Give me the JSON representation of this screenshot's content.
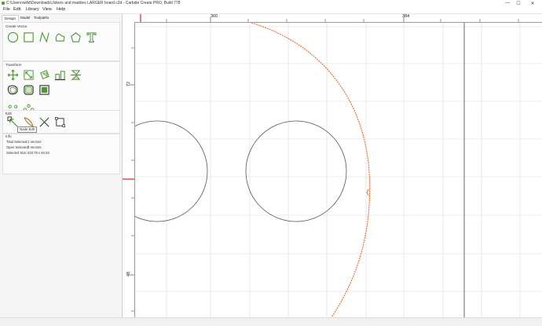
{
  "window": {
    "title": "C:\\Users\\willd\\Downloads\\Jokers and marbles LARGER board.c2d - Carbide Create PRO, Build 778",
    "minimize_glyph": "—",
    "maximize_glyph": "☐",
    "close_glyph": "✕"
  },
  "menu": {
    "file": "File",
    "edit": "Edit",
    "library": "Library",
    "view": "View",
    "help": "Help"
  },
  "tabs": {
    "design": "Design",
    "model": "Model",
    "toolpaths": "Toolpaths"
  },
  "sections": {
    "create_vector": "Create Vector",
    "transform": "Transform",
    "edit": "Edit",
    "info": "Info"
  },
  "tooltip": {
    "text": "Node Edit"
  },
  "info": {
    "total_selected_label": "Total Selected:",
    "total_selected_value": "1 Vectors",
    "open_selected_label": "Open Selected:",
    "open_selected_value": "0 Vectors",
    "selected_size_label": "Selected Size:",
    "selected_size_value": "333.78 x 84.03"
  },
  "rulers": {
    "x_labels": [
      "360",
      "384"
    ],
    "y_labels": [
      "72",
      "48"
    ]
  },
  "colors": {
    "accent_green": "#4c9a2a",
    "selection_orange": "#f26522",
    "ruler_marker": "#e02020",
    "grid": "#dcdcdc"
  },
  "icons": {
    "create_vector": [
      "circle-icon",
      "rectangle-icon",
      "polyline-icon",
      "curve-icon",
      "polygon-icon",
      "text-icon"
    ],
    "transform_row1": [
      "move-icon",
      "scale-icon",
      "rotate-icon",
      "align-icon",
      "mirror-icon"
    ],
    "transform_row2": [
      "offset-icon",
      "fillet-icon",
      "boolean-icon"
    ],
    "transform_row3": [
      "circular-array-icon",
      "rect-array-icon"
    ],
    "edit": [
      "node-edit-icon",
      "trim-icon",
      "knife-icon",
      "bbox-icon"
    ]
  }
}
